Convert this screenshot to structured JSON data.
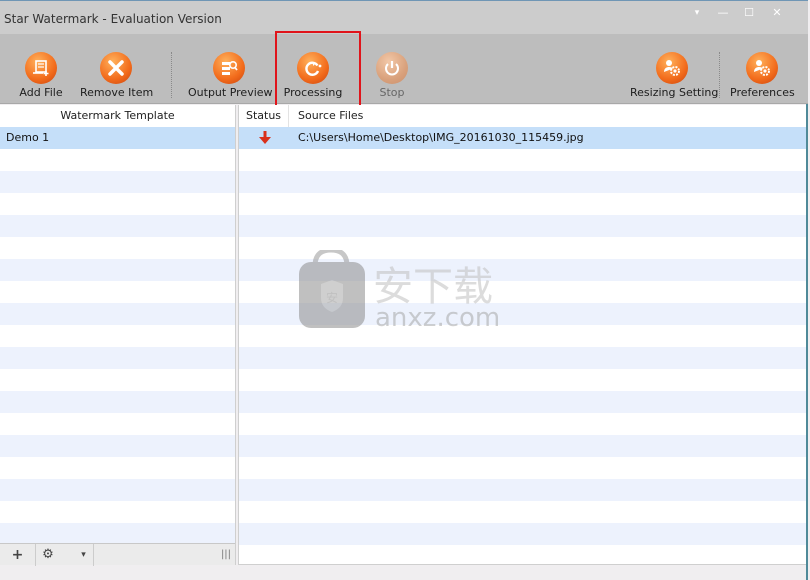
{
  "window": {
    "title": "Star Watermark - Evaluation Version",
    "controls": {
      "options": "▾",
      "minimize": "—",
      "maximize": "☐",
      "close": "✕"
    }
  },
  "toolbar": {
    "buttons": [
      {
        "id": "add-file",
        "label": "Add File",
        "icon": "add-file-icon",
        "enabled": true
      },
      {
        "id": "remove-item",
        "label": "Remove Item",
        "icon": "remove-x-icon",
        "enabled": true
      },
      {
        "id": "output-preview",
        "label": "Output Preview",
        "icon": "preview-search-icon",
        "enabled": true
      },
      {
        "id": "processing",
        "label": "Processing",
        "icon": "refresh-icon",
        "enabled": true,
        "highlighted": true
      },
      {
        "id": "stop",
        "label": "Stop",
        "icon": "power-stop-icon",
        "enabled": false
      },
      {
        "id": "resizing-setting",
        "label": "Resizing Setting",
        "icon": "user-gear-icon",
        "enabled": true
      },
      {
        "id": "preferences",
        "label": "Preferences",
        "icon": "user-gear-icon",
        "enabled": true
      }
    ]
  },
  "template_panel": {
    "header": "Watermark Template",
    "items": [
      {
        "name": "Demo 1",
        "selected": true
      }
    ],
    "bottom": {
      "add": "+",
      "settings": "⚙",
      "dropdown": "▾",
      "grip": "|||"
    }
  },
  "files_panel": {
    "headers": {
      "status": "Status",
      "source": "Source Files"
    },
    "rows": [
      {
        "status_icon": "down-arrow-icon",
        "status_color": "#d9301b",
        "path": "C:\\Users\\Home\\Desktop\\IMG_20161030_115459.jpg",
        "selected": true
      }
    ]
  },
  "watermark_overlay": {
    "cn": "安下载",
    "domain": "anxz.com",
    "badge": "安"
  },
  "colors": {
    "accent_orange": "#f26b1b",
    "selection": "#c5dff9",
    "stripe": "#edf2fd",
    "highlight_box": "#e0141b"
  }
}
